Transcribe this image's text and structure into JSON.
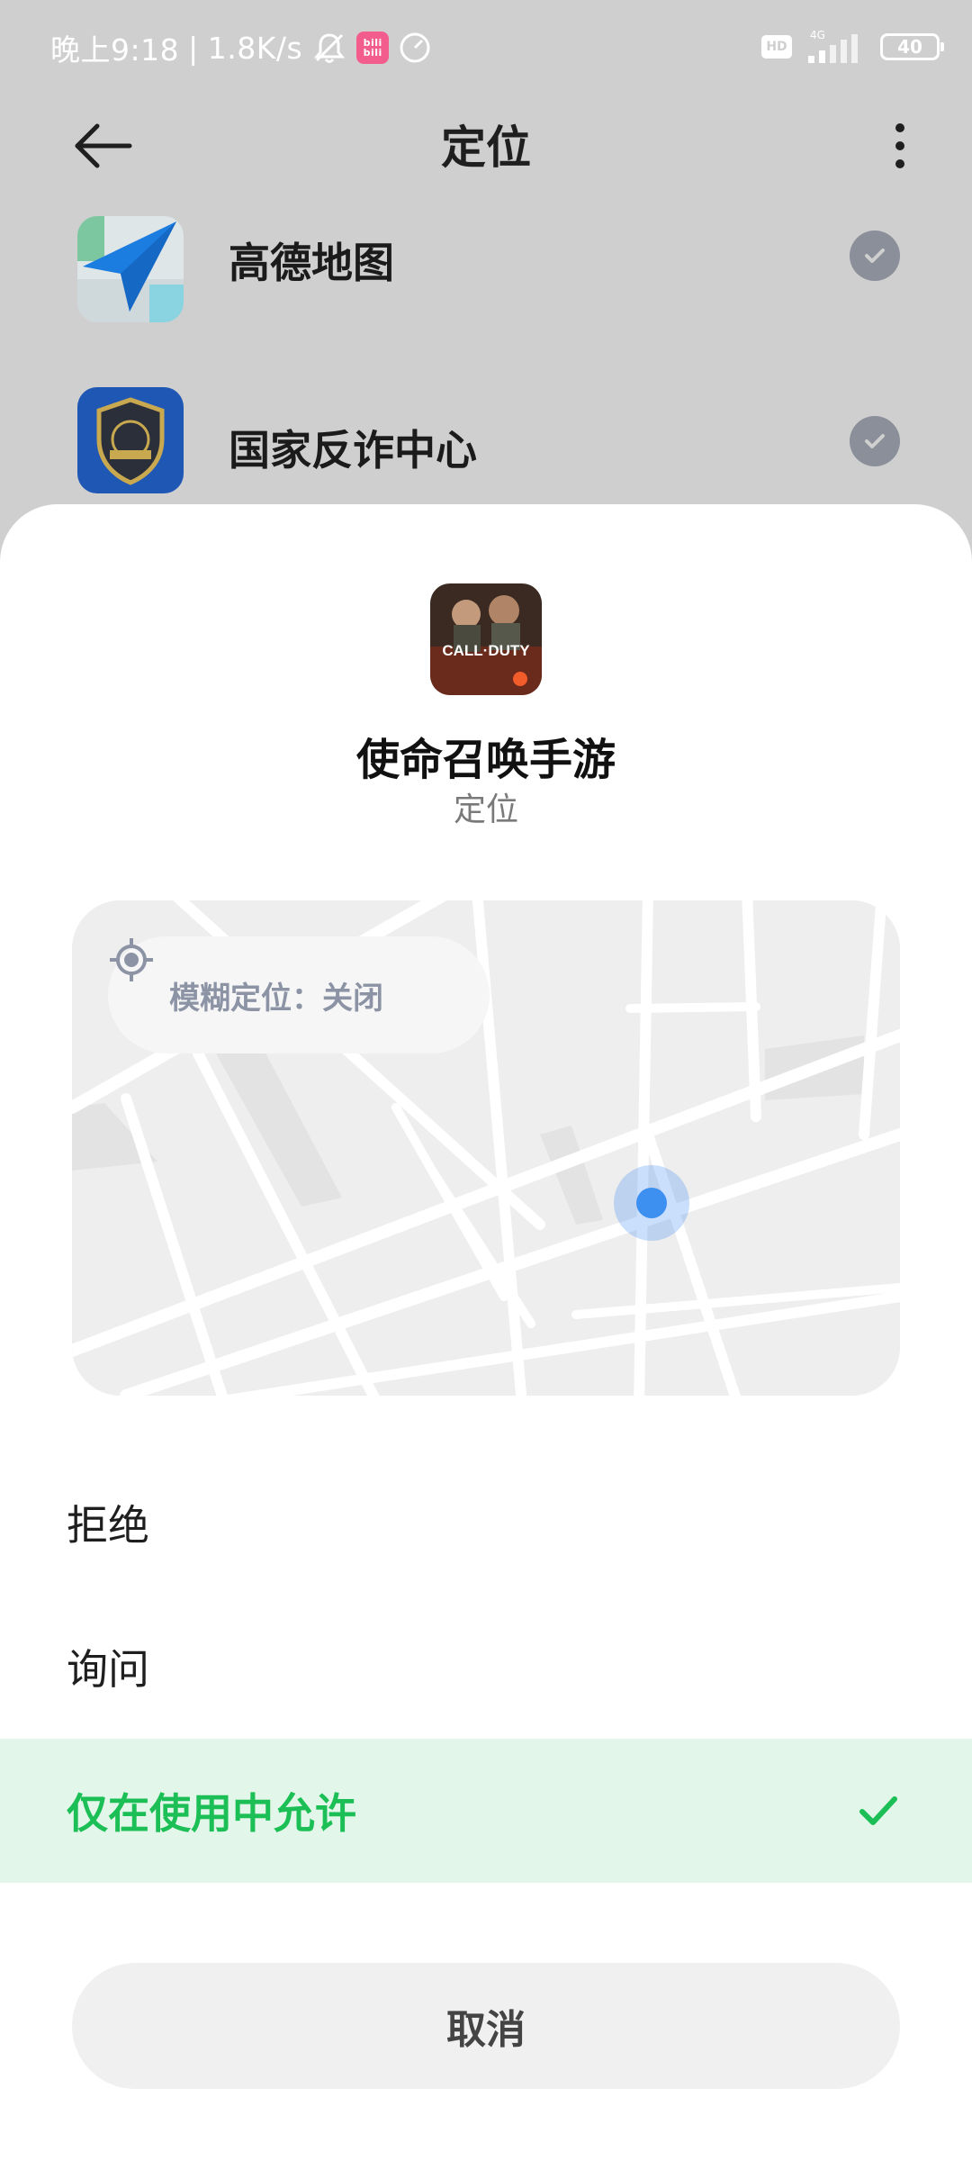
{
  "status_bar": {
    "time": "晚上9:18",
    "net_speed": "1.8K/s",
    "network_type": "4G",
    "battery": "40",
    "icons": [
      "bell-muted-icon",
      "bilibili-icon",
      "speedometer-icon",
      "hd-icon",
      "signal-icon",
      "battery-icon"
    ]
  },
  "header": {
    "title": "定位"
  },
  "app_list": [
    {
      "name": "高德地图",
      "icon": "amap-icon"
    },
    {
      "name": "国家反诈中心",
      "icon": "anti-fraud-icon"
    }
  ],
  "sheet": {
    "app_name": "使命召唤手游",
    "app_icon_text": "CALL·DUTY",
    "permission": "定位",
    "fuzzy_location": "模糊定位：关闭",
    "options": [
      {
        "label": "拒绝",
        "selected": false
      },
      {
        "label": "询问",
        "selected": false
      },
      {
        "label": "仅在使用中允许",
        "selected": true
      }
    ],
    "cancel_label": "取消"
  },
  "colors": {
    "accent_green": "#1bbf55",
    "selected_bg": "#e2f7ea",
    "location_blue": "#3d8ff0",
    "scrim": "#cfcfcf"
  }
}
